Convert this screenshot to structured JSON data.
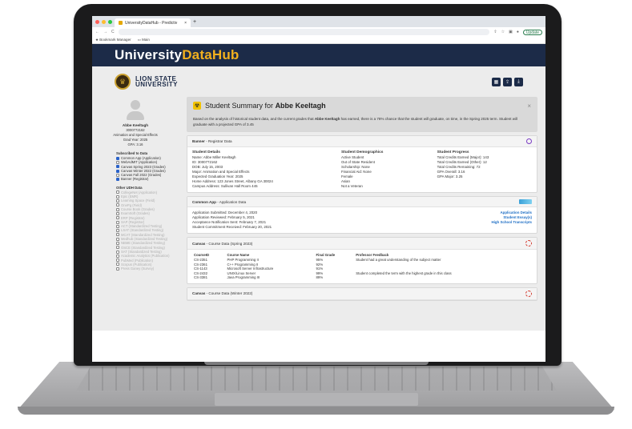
{
  "browser": {
    "tab_title": "UniversityDataHub - Predictiv",
    "update_label": "Update",
    "bookmarks": [
      "Bookmark Manager",
      "Main"
    ]
  },
  "app": {
    "title_part1": "University",
    "title_part2": "DataHub",
    "university_line1": "LION STATE",
    "university_line2": "UNIVERSITY"
  },
  "student": {
    "name": "Abbe Keeltagh",
    "id": "3000772162",
    "major": "Animation and Special Effects",
    "grad_year": "Grad Year: 2025",
    "gpa": "GPA: 3.16"
  },
  "subscribed": {
    "heading": "Subscribed to Data",
    "items": [
      {
        "label": "Common App (Application)",
        "checked": true
      },
      {
        "label": "WebAdMIT (Application)",
        "checked": false
      },
      {
        "label": "Canvas Spring 2023 (Grades)",
        "checked": true
      },
      {
        "label": "Canvas Winter 2022 (Grades)",
        "checked": true
      },
      {
        "label": "Canvas Fall 2022 (Grades)",
        "checked": false
      },
      {
        "label": "Banner (Registrar)",
        "checked": true
      }
    ]
  },
  "other": {
    "heading": "Other UDH Data",
    "items": [
      "CollegeNet (Application)",
      "Epic (EMR)",
      "Learning Space (Field)",
      "OnePg (Field)",
      "Course Book (Grades)",
      "ExamSoft (Grades)",
      "ERP (Registrar)",
      "SAP (Registrar)",
      "ACT (Standardized Testing)",
      "LSAT (Standardized Testing)",
      "MCAT (Standardized Testing)",
      "Medhub (Standardized Testing)",
      "NBME (Standardized Testing)",
      "OSCE (Standardized Testing)",
      "SAT (Standardized Testing)",
      "Academic Analytics (Publication)",
      "PubMed (Publication)",
      "Scopus (Publication)",
      "Press Ganey (Survey)"
    ]
  },
  "summary": {
    "title_prefix": "Student Summary for",
    "title_name": "Abbe Keeltagh",
    "text_a": "Based on the analysis of historical student data, and the current grades that",
    "text_name": "Abbe Keeltagh",
    "text_b": "has earned, there is a 78% chance that the student will graduate, on time, in the Spring 2025 term. Student will graduate with a projected GPA of 3.45"
  },
  "banner": {
    "source": "Banner",
    "label": "- Registrar Data",
    "details_heading": "Student Details",
    "details": [
      "Name: Abbe Miller Keeltagh",
      "ID: 3000772162",
      "DOB: July 15, 2003",
      "Major: Animation and Special Effects",
      "Expected Graduation Year: 2025",
      "Home Address: 123 Jones Street, Albany GA 30024",
      "Campus Address: Sullivan Hall Room 445"
    ],
    "demographics_heading": "Student Demographics",
    "demographics": [
      "Active Student",
      "Out of State Resident",
      "Scholarship: None",
      "Financial Aid: None",
      "Female",
      "Asian",
      "Not a Veteran"
    ],
    "progress_heading": "Student Progress",
    "progress": [
      "Total Credits Earned (Major): 143",
      "Total Credits Earned (Other): 12",
      "Total Credits Remaining: 72",
      "GPA Overall: 3.16",
      "GPA Major: 3.25"
    ]
  },
  "commonapp": {
    "source": "Common App",
    "label": "- Application Data",
    "lines": [
      "Application Submitted: December 4, 2020",
      "Application Reviewed: February 5, 2021",
      "Acceptance Notification Sent: February 7, 2021",
      "Student Commitment Received: February 20, 2021"
    ],
    "links": [
      "Application Details",
      "Student Essay(s)",
      "High School Transcripts"
    ]
  },
  "canvas_spring": {
    "source": "Canvas",
    "label": "- Course Data (Spring 2023)",
    "headers": [
      "CourseID",
      "Course Name",
      "Final Grade",
      "Professor Feedback"
    ],
    "rows": [
      [
        "CS-2351",
        "PHP Programming II",
        "95%",
        "Student had a great understanding of the subject matter"
      ],
      [
        "CS-2361",
        "C++ Programming II",
        "92%",
        ""
      ],
      [
        "CS-1143",
        "Microsoft Server Infrastructure",
        "91%",
        ""
      ],
      [
        "CS-2432",
        "UNIX/Linux Server",
        "99%",
        "Student completed the term with the highest grade in this class"
      ],
      [
        "CS-3381",
        "Java Programming III",
        "89%",
        ""
      ]
    ]
  },
  "canvas_winter": {
    "source": "Canvas",
    "label": "- Course Data (Winter 2022)"
  }
}
